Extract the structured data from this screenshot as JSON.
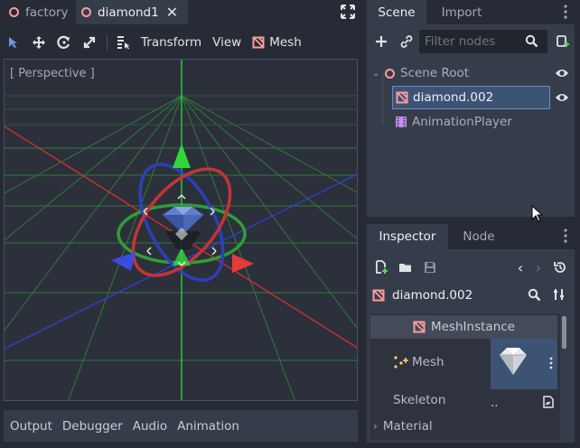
{
  "editor_tabs": [
    {
      "label": "factory"
    },
    {
      "label": "diamond1"
    }
  ],
  "toolbar": {
    "transform_menu": "Transform",
    "view_menu": "View",
    "mesh_menu": "Mesh"
  },
  "viewport": {
    "perspective_label": "[ Perspective ]"
  },
  "bottom_tabs": [
    "Output",
    "Debugger",
    "Audio",
    "Animation"
  ],
  "scene_dock": {
    "tabs": [
      "Scene",
      "Import"
    ],
    "filter_placeholder": "Filter nodes",
    "nodes": [
      {
        "label": "Scene Root",
        "icon": "spatial-node-icon"
      },
      {
        "label": "diamond.002",
        "icon": "mesh-instance-icon",
        "selected": true
      },
      {
        "label": "AnimationPlayer",
        "icon": "animation-player-icon"
      }
    ]
  },
  "inspector": {
    "tabs": [
      "Inspector",
      "Node"
    ],
    "object_name": "diamond.002",
    "section_header": "MeshInstance",
    "properties": [
      {
        "label": "Mesh"
      },
      {
        "label": "Skeleton",
        "value": ".."
      },
      {
        "label": "Material"
      }
    ]
  },
  "colors": {
    "accent": "#6f93e6",
    "background": "#272b35",
    "panel": "#363d4a",
    "selected_row": "#3d5373",
    "x_axis": "#e33a3a",
    "y_axis": "#32d637",
    "z_axis": "#3a4be3"
  }
}
